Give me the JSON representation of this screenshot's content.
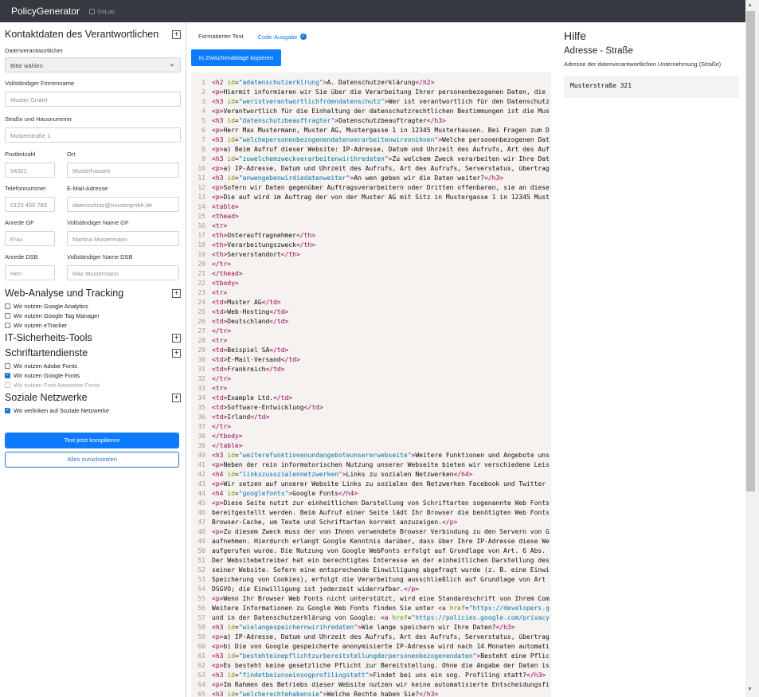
{
  "nav": {
    "brand": "PolicyGenerator",
    "gitlab": "GitLab"
  },
  "form": {
    "contact_title": "Kontaktdaten des Verantwortlichen",
    "responsible_label": "Datenverantwortlicher",
    "responsible_value": "Bitte wählen",
    "company_label": "Vollständiger Firmenname",
    "company_ph": "Muster GmbH",
    "street_label": "Straße und Hausnummer",
    "street_ph": "Musterstraße 1",
    "zip_label": "Postleitzahl",
    "zip_ph": "54321",
    "city_label": "Ort",
    "city_ph": "Musterhausen",
    "phone_label": "Telefonnummer",
    "phone_ph": "0123 456 789",
    "email_label": "E-Mail-Adresse",
    "email_ph": "datenschutz@mustergmbh.de",
    "salut_gf_label": "Anrede GF",
    "salut_gf_ph": "Frau",
    "name_gf_label": "Vollständiger Name GF",
    "name_gf_ph": "Martina Mustermann",
    "salut_dsb_label": "Anrede DSB",
    "salut_dsb_ph": "Herr",
    "name_dsb_label": "Vollständiger Name DSB",
    "name_dsb_ph": "Max Mustermann",
    "web_title": "Web-Analyse und Tracking",
    "web_items": [
      {
        "label": "Wir nutzen Google Analytics",
        "checked": false
      },
      {
        "label": "Wir nutzen Google Tag Manager",
        "checked": false
      },
      {
        "label": "Wir nutzen eTracker",
        "checked": false
      }
    ],
    "it_title": "IT-Sicherheits-Tools",
    "font_title": "Schriftartendienste",
    "font_items": [
      {
        "label": "Wir nutzen Adobe Fonts",
        "checked": false
      },
      {
        "label": "Wir nutzen Google Fonts",
        "checked": true
      },
      {
        "label": "Wir nutzen Font Awesome Fonts",
        "checked": false,
        "disabled": true
      }
    ],
    "social_title": "Soziale Netzwerke",
    "social_items": [
      {
        "label": "Wir verlinken auf Soziale Netzwerke",
        "checked": true
      }
    ],
    "compile": "Text jetzt kompilieren",
    "reset": "Alles zurücksetzen"
  },
  "tabs": {
    "formatted": "Formatierter Text",
    "code": "Code-Ausgabe"
  },
  "copy": "In Zwischenablage kopieren",
  "code_lines": [
    "<h2 id=\"adatenschutzerklrung\">A. Datenschutzerklärung</h2>",
    "<p>Hiermit informieren wir Sie über die Verarbeitung Ihrer personenbezogenen Daten, die",
    "<h3 id=\"weristverantwortlichfrdendatenschutz\">Wer ist verantwortlich für den Datenschutz",
    "<p>Verantwortlich für die Einhaltung der datenschutzrechtlichen Bestimmungen ist die Mus",
    "<h3 id=\"datenschutzbeauftragter\">Datenschutzbeauftragter</h3>",
    "<p>Herr Max Mustermann, Muster AG, Mustergasse 1 in 12345 Musterhausen. Bei Fragen zum D",
    "<h3 id=\"welchepersonenbezogenendatenverarbeitenwirvonihnen\">Welche personenbezogenen Dat",
    "<p>a) Beim Aufruf dieser Website: IP-Adresse, Datum und Uhrzeit des Aufrufs, Art des Auf",
    "<h3 id=\"zuwelchemzweckverarbeitenwirihredaten\">Zu welchem Zweck verarbeiten wir Ihre Dat",
    "<p>a) IP-Adresse, Datum und Uhrzeit des Aufrufs, Art des Aufrufs, Serverstatus, übertrag",
    "<h3 id=\"anwengebenwirdiedatenweiter\">An wen geben wir die Daten weiter?</h3>",
    "<p>Sofern wir Daten gegenüber Auftragsverarbeitern oder Dritten offenbaren, sie an diese",
    "<p>Die auf wird im Auftrag der von der Muster AG mit Sitz in Mustergasse 1 in 12345 Must",
    "<table>",
    "<thead>",
    "<tr>",
    "<th>Unterauftragnehmer</th>",
    "<th>Verarbeitungszweck</th>",
    "<th>Serverstandort</th>",
    "</tr>",
    "</thead>",
    "<tbody>",
    "<tr>",
    "<td>Muster AG</td>",
    "<td>Web-Hosting</td>",
    "<td>Deutschland</td>",
    "</tr>",
    "<tr>",
    "<td>Beispiel SA</td>",
    "<td>E-Mail-Versand</td>",
    "<td>Frankreich</td>",
    "</tr>",
    "<tr>",
    "<td>Example Ltd.</td>",
    "<td>Software-Entwicklung</td>",
    "<td>Irland</td>",
    "</tr>",
    "</tbody>",
    "</table>",
    "<h3 id=\"weiterefunktionenundangeboteunsererwebseite\">Weitere Funktionen und Angebote uns",
    "<p>Neben der rein informatorischen Nutzung unserer Webseite bieten wir verschiedene Leis",
    "<h4 id=\"linkszusozialennetzwerken\">Links zu sozialen Netzwerken</h4>",
    "<p>Wir setzen auf unserer Website Links zu sozialen den Netzwerken Facebook und Twitter",
    "<h4 id=\"googlefonts\">Google Fonts</h4>",
    "<p>Diese Seite nutzt zur einheitlichen Darstellung von Schriftarten sogenannte Web Fonts",
    "bereitgestellt werden. Beim Aufruf einer Seite lädt Ihr Browser die benötigten Web Fonts",
    "Browser-Cache, um Texte und Schriftarten korrekt anzuzeigen.</p>",
    "<p>Zu diesem Zweck muss der von Ihnen verwendete Browser Verbindung zu den Servern von G",
    "aufnehmen. Hierdurch erlangt Google Kenntnis darüber, dass über Ihre IP-Adresse diese We",
    "aufgerufen wurde. Die Nutzung von Google WebFonts erfolgt auf Grundlage von Art. 6 Abs.",
    "Der Websitebetreiber hat ein berechtigtes Interesse an der einheitlichen Darstellung des",
    "seiner Website. Sofern eine entsprechende Einwilligung abgefragt wurde (z. B. eine Einwi",
    "Speicherung von Cookies), erfolgt die Verarbeitung ausschließlich auf Grundlage von Art",
    "DSGVO; die Einwilligung ist jederzeit widerrufbar.</p>",
    "<p>Wenn Ihr Browser Web Fonts nicht unterstützt, wird eine Standardschrift von Ihrem Com",
    "Weitere Informationen zu Google Web Fonts finden Sie unter <a href=\"https://developers.g",
    "und in der Datenschutzerklärung von Google: <a href=\"https://policies.google.com/privacy",
    "<h3 id=\"wielangespeichernwirihredaten\">Wie lange speichern wir Ihre Daten?</h3>",
    "<p>a) IP-Adresse, Datum und Uhrzeit des Aufrufs, Art des Aufrufs, Serverstatus, übertrag",
    "<p>b) Die von Google gespeicherte anonymisierte IP-Adresse wird nach 14 Monaten automati",
    "<h3 id=\"bestehteinepflichtzurbereitstellungderpersonenbezogenendaten\">Besteht eine Pflic",
    "<p>Es besteht keine gesetzliche Pflicht zur Bereitstellung. Ohne die Angabe der Daten is",
    "<h3 id=\"findetbeiunseinsogprofilingstatt\">Findet bei uns ein sog. Profiling statt?</h3>",
    "<p>Im Rahmen des Betriebs dieser Website nutzen wir keine automatisierte Entscheidungsfi",
    "<h3 id=\"welcherechtehabensie\">Welche Rechte haben Sie?</h3>"
  ],
  "help": {
    "title": "Hilfe",
    "subtitle": "Adresse - Straße",
    "desc": "Adresse der datenverantwortlichen Unternehmung (Straße)",
    "example": "Musterstraße 321"
  }
}
